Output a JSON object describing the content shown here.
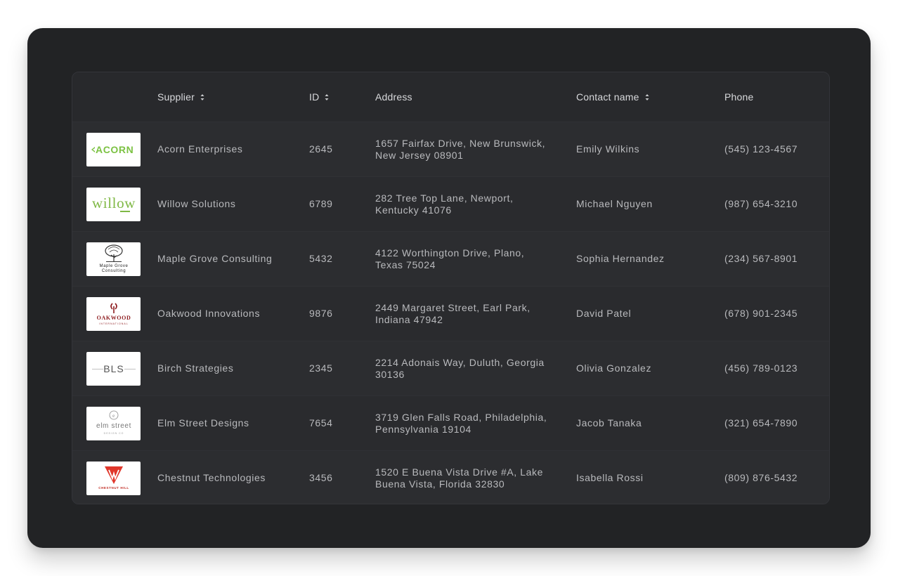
{
  "table": {
    "headers": {
      "supplier": "Supplier",
      "id": "ID",
      "address": "Address",
      "contact": "Contact name",
      "phone": "Phone"
    },
    "rows": [
      {
        "logo": "acorn-logo",
        "logo_text": "ACORN",
        "supplier": "Acorn Enterprises",
        "id": "2645",
        "address": "1657 Fairfax Drive, New Brunswick, New Jersey 08901",
        "contact": "Emily Wilkins",
        "phone": "(545) 123-4567"
      },
      {
        "logo": "willow-logo",
        "logo_text": "willow",
        "supplier": "Willow Solutions",
        "id": "6789",
        "address": "282 Tree Top Lane, Newport, Kentucky 41076",
        "contact": "Michael Nguyen",
        "phone": "(987) 654-3210"
      },
      {
        "logo": "maple-grove-logo",
        "logo_text": "Maple Grove Consulting",
        "supplier": "Maple Grove Consulting",
        "id": "5432",
        "address": "4122 Worthington Drive, Plano, Texas 75024",
        "contact": "Sophia Hernandez",
        "phone": "(234) 567-8901"
      },
      {
        "logo": "oakwood-logo",
        "logo_text": "OAKWOOD",
        "logo_subtext": "INTERNATIONAL",
        "supplier": "Oakwood Innovations",
        "id": "9876",
        "address": "2449 Margaret Street, Earl Park, Indiana 47942",
        "contact": "David Patel",
        "phone": "(678) 901-2345"
      },
      {
        "logo": "bls-logo",
        "logo_text": "BLS",
        "supplier": "Birch Strategies",
        "id": "2345",
        "address": "2214 Adonais Way, Duluth, Georgia 30136",
        "contact": "Olivia Gonzalez",
        "phone": "(456) 789-0123"
      },
      {
        "logo": "elm-street-logo",
        "logo_text": "elm street",
        "logo_subtext": "DESIGN CO",
        "supplier": "Elm Street Designs",
        "id": "7654",
        "address": "3719 Glen Falls Road, Philadelphia, Pennsylvania 19104",
        "contact": "Jacob Tanaka",
        "phone": "(321) 654-7890"
      },
      {
        "logo": "chestnut-hill-logo",
        "logo_text": "CHESTNUT HILL",
        "supplier": "Chestnut Technologies",
        "id": "3456",
        "address": "1520 E Buena Vista Drive #A, Lake Buena Vista, Florida 32830",
        "contact": "Isabella Rossi",
        "phone": "(809) 876-5432"
      }
    ]
  },
  "colors": {
    "window_bg": "#222325",
    "card_bg": "#2a2b2e",
    "header_text": "#d8d9dc",
    "cell_text": "#b9babd",
    "acorn_green": "#7cc243",
    "willow_green": "#7fb845",
    "oakwood_red": "#8e1c1f",
    "chestnut_red": "#e0372b"
  }
}
